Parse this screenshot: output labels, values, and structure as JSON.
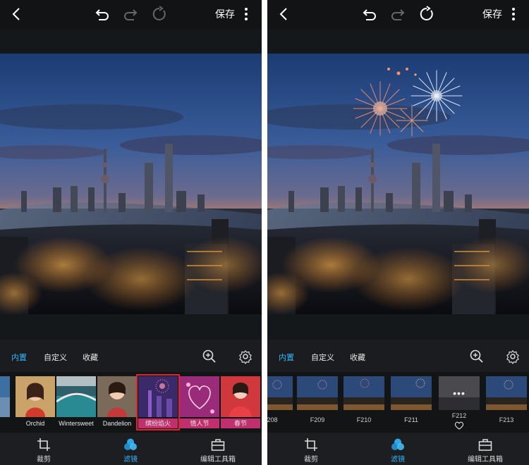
{
  "header": {
    "save_label": "保存"
  },
  "tabs": {
    "builtin": "内置",
    "custom": "自定义",
    "favorites": "收藏"
  },
  "left_strip": [
    {
      "label": ""
    },
    {
      "label": "Orchid"
    },
    {
      "label": "Wintersweet"
    },
    {
      "label": "Dandelion"
    },
    {
      "label": "缤纷焰火"
    },
    {
      "label": "情人节"
    },
    {
      "label": "春节"
    }
  ],
  "right_strip": [
    {
      "label": "208"
    },
    {
      "label": "F209"
    },
    {
      "label": "F210"
    },
    {
      "label": "F211"
    },
    {
      "label": "F212"
    },
    {
      "label": "F213"
    }
  ],
  "bottom_nav": {
    "crop": "裁剪",
    "filter": "滤镜",
    "toolbox": "编辑工具箱"
  },
  "colors": {
    "accent": "#31b7ff",
    "selection": "#e0242a",
    "background": "#0e1012"
  }
}
